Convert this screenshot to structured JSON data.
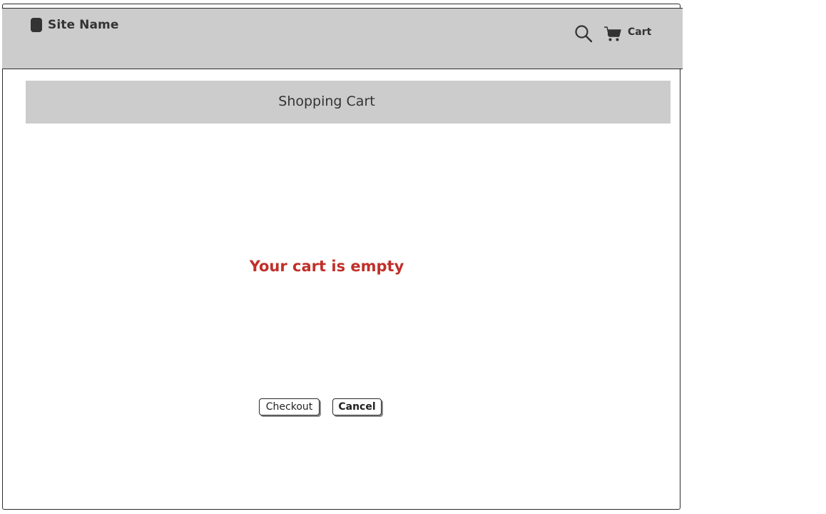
{
  "header": {
    "site_name": "Site Name",
    "icons": [
      "logo-icon",
      "search-icon",
      "cart-icon"
    ],
    "cart_label": "Cart"
  },
  "main": {
    "title": "Shopping Cart",
    "empty_message": "Your cart is empty",
    "buttons": {
      "checkout_label": "Checkout",
      "cancel_label": "Cancel"
    }
  },
  "colors": {
    "header_bg": "#cccccc",
    "title_bar_bg": "#cccccc",
    "empty_message": "#c0302a",
    "border": "#2b2b2b"
  }
}
